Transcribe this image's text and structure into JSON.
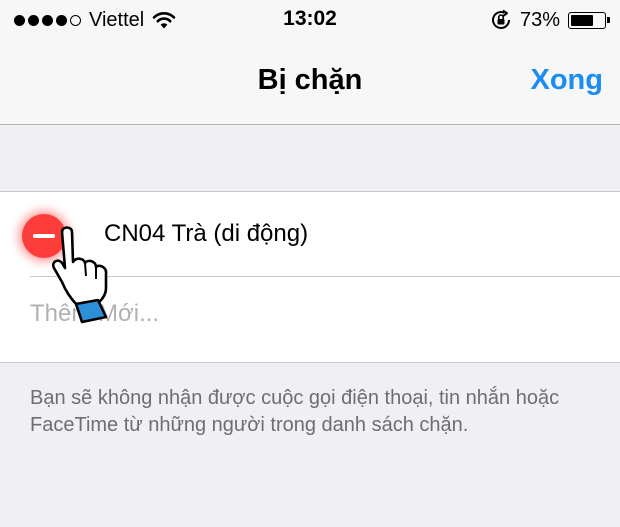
{
  "status_bar": {
    "carrier": "Viettel",
    "signal_bars_filled": 4,
    "signal_bars_total": 5,
    "time": "13:02",
    "battery_percent": "73%",
    "battery_level": 0.73,
    "icons": [
      "wifi-icon",
      "orientation-lock-icon",
      "battery-icon"
    ]
  },
  "nav": {
    "title": "Bị chặn",
    "done_label": "Xong",
    "accent_color": "#1a8cf2"
  },
  "blocked_list": {
    "contacts": [
      {
        "name": "CN04 Trà (di động)",
        "action_icon": "delete-minus-icon"
      }
    ],
    "add_new_label": "Thêm Mới..."
  },
  "footer": {
    "text": "Bạn sẽ không nhận được cuộc gọi điện thoại, tin nhắn hoặc FaceTime từ những người trong danh sách chặn."
  },
  "colors": {
    "delete_red": "#fc3d39",
    "background": "#efeff4"
  }
}
